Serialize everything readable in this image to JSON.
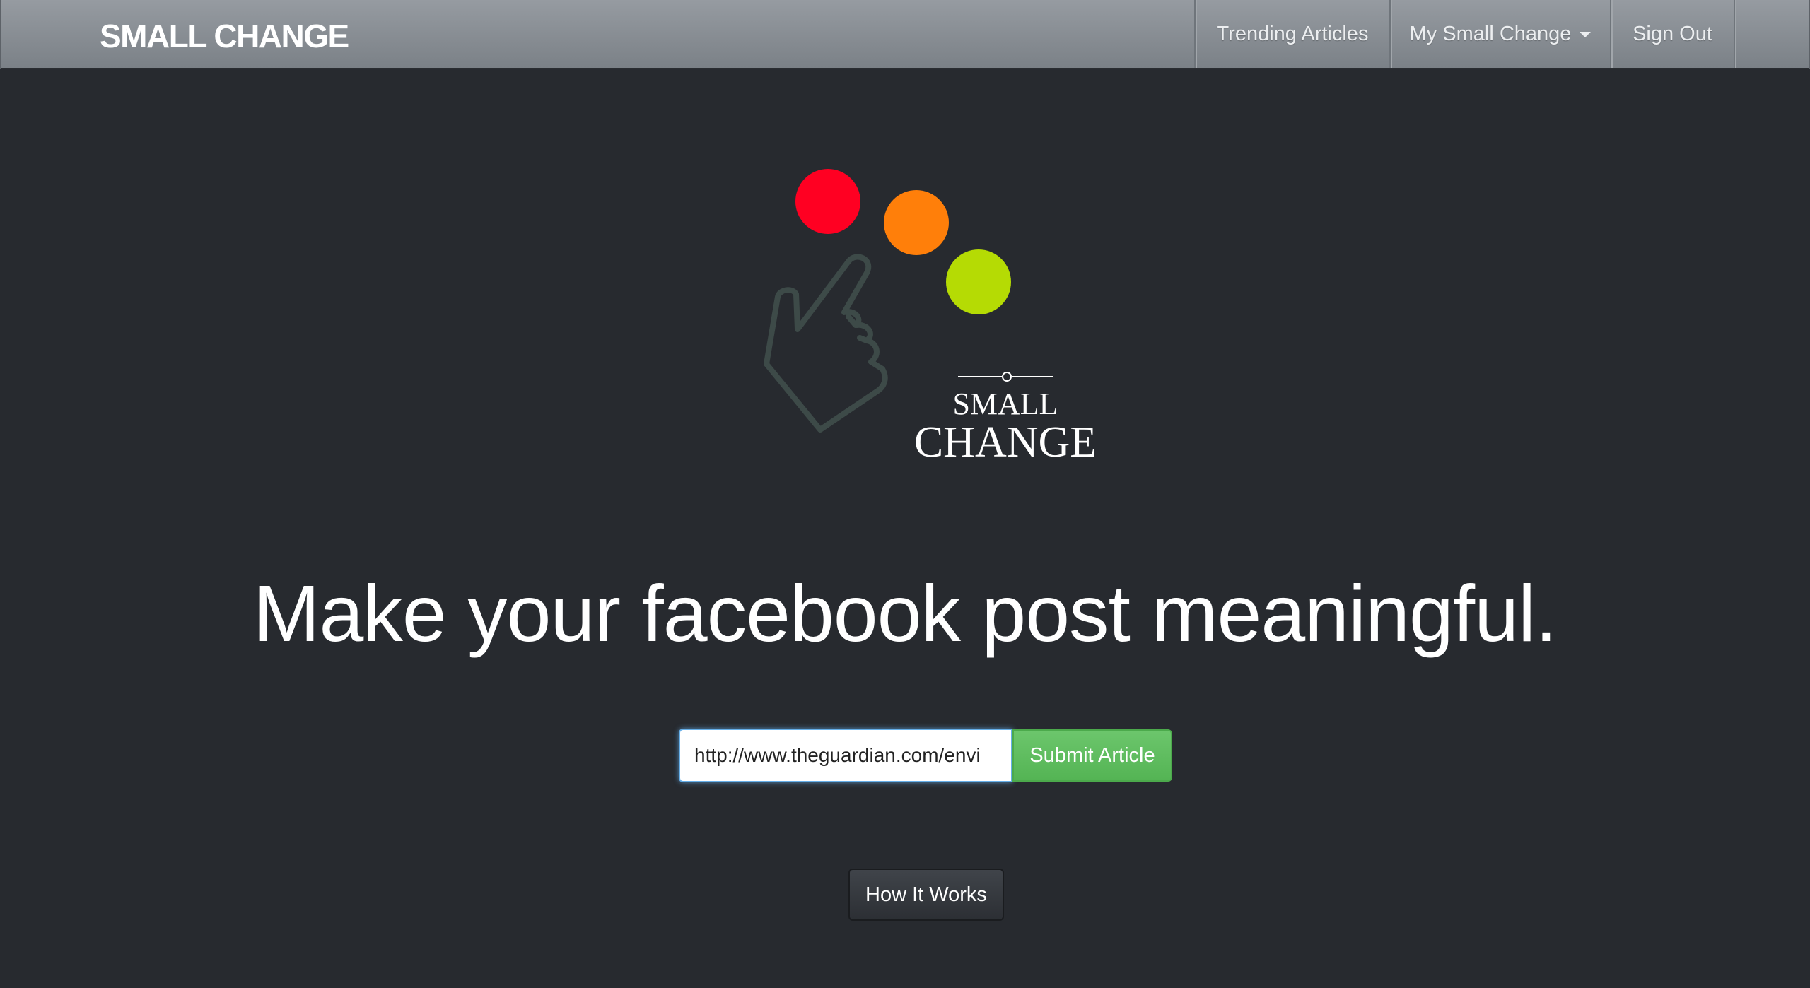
{
  "nav": {
    "brand": "SMALL CHANGE",
    "trending": "Trending Articles",
    "my_small_change": "My Small Change",
    "sign_out": "Sign Out"
  },
  "logo": {
    "line1": "SMALL",
    "line2": "CHANGE",
    "icon": "pointing-hand-icon",
    "dot_colors": [
      "#ff0022",
      "#ff7f0a",
      "#b5db04"
    ]
  },
  "hero": {
    "headline": "Make your facebook post meaningful."
  },
  "form": {
    "url_value": "http://www.theguardian.com/envi",
    "submit_label": "Submit Article"
  },
  "how_it_works": {
    "label": "How It Works"
  }
}
